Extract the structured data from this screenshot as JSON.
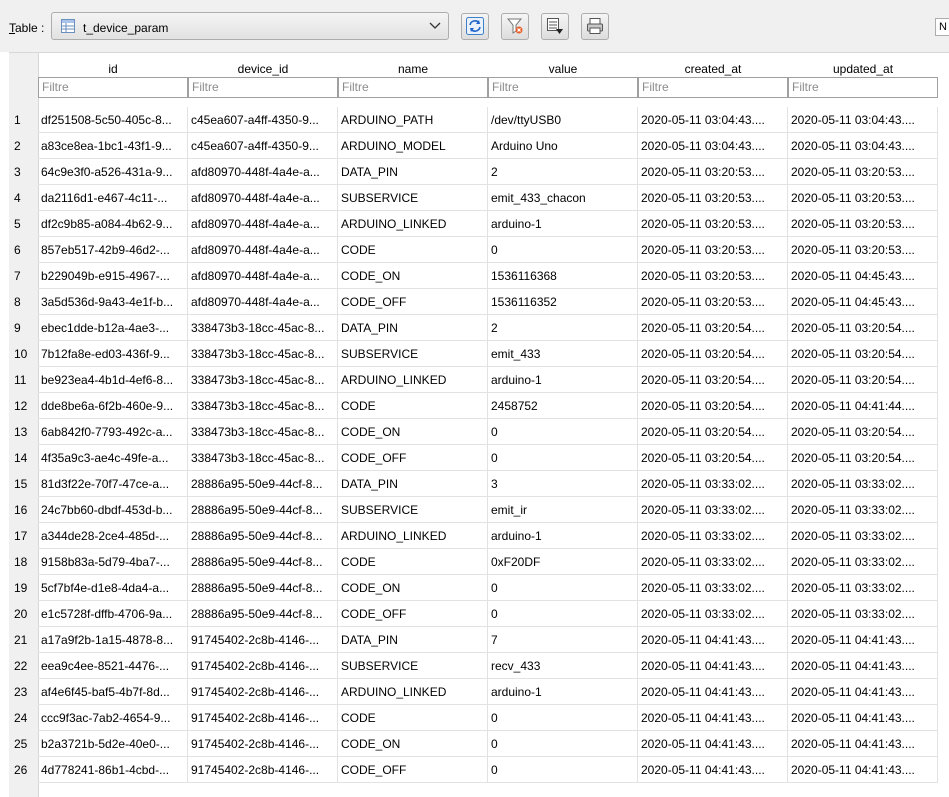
{
  "toolbar": {
    "table_label_prefix": "T",
    "table_label_rest": "able :",
    "table_selected": "t_device_param",
    "buttons": [
      {
        "name": "refresh-button",
        "icon": "refresh-icon"
      },
      {
        "name": "clear-filters-button",
        "icon": "filter-clear-icon"
      },
      {
        "name": "export-button",
        "icon": "export-icon"
      },
      {
        "name": "print-button",
        "icon": "printer-icon"
      }
    ],
    "right_tag": "N"
  },
  "table": {
    "columns": [
      "id",
      "device_id",
      "name",
      "value",
      "created_at",
      "updated_at"
    ],
    "filter_placeholder": "Filtre",
    "rows": [
      {
        "n": "1",
        "id": "df251508-5c50-405c-8...",
        "device_id": "c45ea607-a4ff-4350-9...",
        "name": "ARDUINO_PATH",
        "value": "/dev/ttyUSB0",
        "created_at": "2020-05-11 03:04:43....",
        "updated_at": "2020-05-11 03:04:43...."
      },
      {
        "n": "2",
        "id": "a83ce8ea-1bc1-43f1-9...",
        "device_id": "c45ea607-a4ff-4350-9...",
        "name": "ARDUINO_MODEL",
        "value": "Arduino Uno",
        "created_at": "2020-05-11 03:04:43....",
        "updated_at": "2020-05-11 03:04:43...."
      },
      {
        "n": "3",
        "id": "64c9e3f0-a526-431a-9...",
        "device_id": "afd80970-448f-4a4e-a...",
        "name": "DATA_PIN",
        "value": "2",
        "created_at": "2020-05-11 03:20:53....",
        "updated_at": "2020-05-11 03:20:53...."
      },
      {
        "n": "4",
        "id": "da2116d1-e467-4c11-...",
        "device_id": "afd80970-448f-4a4e-a...",
        "name": "SUBSERVICE",
        "value": "emit_433_chacon",
        "created_at": "2020-05-11 03:20:53....",
        "updated_at": "2020-05-11 03:20:53...."
      },
      {
        "n": "5",
        "id": "df2c9b85-a084-4b62-9...",
        "device_id": "afd80970-448f-4a4e-a...",
        "name": "ARDUINO_LINKED",
        "value": "arduino-1",
        "created_at": "2020-05-11 03:20:53....",
        "updated_at": "2020-05-11 03:20:53...."
      },
      {
        "n": "6",
        "id": "857eb517-42b9-46d2-...",
        "device_id": "afd80970-448f-4a4e-a...",
        "name": "CODE",
        "value": "0",
        "created_at": "2020-05-11 03:20:53....",
        "updated_at": "2020-05-11 03:20:53...."
      },
      {
        "n": "7",
        "id": "b229049b-e915-4967-...",
        "device_id": "afd80970-448f-4a4e-a...",
        "name": "CODE_ON",
        "value": "1536116368",
        "created_at": "2020-05-11 03:20:53....",
        "updated_at": "2020-05-11 04:45:43...."
      },
      {
        "n": "8",
        "id": "3a5d536d-9a43-4e1f-b...",
        "device_id": "afd80970-448f-4a4e-a...",
        "name": "CODE_OFF",
        "value": "1536116352",
        "created_at": "2020-05-11 03:20:53....",
        "updated_at": "2020-05-11 04:45:43...."
      },
      {
        "n": "9",
        "id": "ebec1dde-b12a-4ae3-...",
        "device_id": "338473b3-18cc-45ac-8...",
        "name": "DATA_PIN",
        "value": "2",
        "created_at": "2020-05-11 03:20:54....",
        "updated_at": "2020-05-11 03:20:54...."
      },
      {
        "n": "10",
        "id": "7b12fa8e-ed03-436f-9...",
        "device_id": "338473b3-18cc-45ac-8...",
        "name": "SUBSERVICE",
        "value": "emit_433",
        "created_at": "2020-05-11 03:20:54....",
        "updated_at": "2020-05-11 03:20:54...."
      },
      {
        "n": "11",
        "id": "be923ea4-4b1d-4ef6-8...",
        "device_id": "338473b3-18cc-45ac-8...",
        "name": "ARDUINO_LINKED",
        "value": "arduino-1",
        "created_at": "2020-05-11 03:20:54....",
        "updated_at": "2020-05-11 03:20:54...."
      },
      {
        "n": "12",
        "id": "dde8be6a-6f2b-460e-9...",
        "device_id": "338473b3-18cc-45ac-8...",
        "name": "CODE",
        "value": "2458752",
        "created_at": "2020-05-11 03:20:54....",
        "updated_at": "2020-05-11 04:41:44...."
      },
      {
        "n": "13",
        "id": "6ab842f0-7793-492c-a...",
        "device_id": "338473b3-18cc-45ac-8...",
        "name": "CODE_ON",
        "value": "0",
        "created_at": "2020-05-11 03:20:54....",
        "updated_at": "2020-05-11 03:20:54...."
      },
      {
        "n": "14",
        "id": "4f35a9c3-ae4c-49fe-a...",
        "device_id": "338473b3-18cc-45ac-8...",
        "name": "CODE_OFF",
        "value": "0",
        "created_at": "2020-05-11 03:20:54....",
        "updated_at": "2020-05-11 03:20:54...."
      },
      {
        "n": "15",
        "id": "81d3f22e-70f7-47ce-a...",
        "device_id": "28886a95-50e9-44cf-8...",
        "name": "DATA_PIN",
        "value": "3",
        "created_at": "2020-05-11 03:33:02....",
        "updated_at": "2020-05-11 03:33:02...."
      },
      {
        "n": "16",
        "id": "24c7bb60-dbdf-453d-b...",
        "device_id": "28886a95-50e9-44cf-8...",
        "name": "SUBSERVICE",
        "value": "emit_ir",
        "created_at": "2020-05-11 03:33:02....",
        "updated_at": "2020-05-11 03:33:02...."
      },
      {
        "n": "17",
        "id": "a344de28-2ce4-485d-...",
        "device_id": "28886a95-50e9-44cf-8...",
        "name": "ARDUINO_LINKED",
        "value": "arduino-1",
        "created_at": "2020-05-11 03:33:02....",
        "updated_at": "2020-05-11 03:33:02...."
      },
      {
        "n": "18",
        "id": "9158b83a-5d79-4ba7-...",
        "device_id": "28886a95-50e9-44cf-8...",
        "name": "CODE",
        "value": "0xF20DF",
        "created_at": "2020-05-11 03:33:02....",
        "updated_at": "2020-05-11 03:33:02...."
      },
      {
        "n": "19",
        "id": "5cf7bf4e-d1e8-4da4-a...",
        "device_id": "28886a95-50e9-44cf-8...",
        "name": "CODE_ON",
        "value": "0",
        "created_at": "2020-05-11 03:33:02....",
        "updated_at": "2020-05-11 03:33:02...."
      },
      {
        "n": "20",
        "id": "e1c5728f-dffb-4706-9a...",
        "device_id": "28886a95-50e9-44cf-8...",
        "name": "CODE_OFF",
        "value": "0",
        "created_at": "2020-05-11 03:33:02....",
        "updated_at": "2020-05-11 03:33:02...."
      },
      {
        "n": "21",
        "id": "a17a9f2b-1a15-4878-8...",
        "device_id": "91745402-2c8b-4146-...",
        "name": "DATA_PIN",
        "value": "7",
        "created_at": "2020-05-11 04:41:43....",
        "updated_at": "2020-05-11 04:41:43...."
      },
      {
        "n": "22",
        "id": "eea9c4ee-8521-4476-...",
        "device_id": "91745402-2c8b-4146-...",
        "name": "SUBSERVICE",
        "value": "recv_433",
        "created_at": "2020-05-11 04:41:43....",
        "updated_at": "2020-05-11 04:41:43...."
      },
      {
        "n": "23",
        "id": "af4e6f45-baf5-4b7f-8d...",
        "device_id": "91745402-2c8b-4146-...",
        "name": "ARDUINO_LINKED",
        "value": "arduino-1",
        "created_at": "2020-05-11 04:41:43....",
        "updated_at": "2020-05-11 04:41:43...."
      },
      {
        "n": "24",
        "id": "ccc9f3ac-7ab2-4654-9...",
        "device_id": "91745402-2c8b-4146-...",
        "name": "CODE",
        "value": "0",
        "created_at": "2020-05-11 04:41:43....",
        "updated_at": "2020-05-11 04:41:43...."
      },
      {
        "n": "25",
        "id": "b2a3721b-5d2e-40e0-...",
        "device_id": "91745402-2c8b-4146-...",
        "name": "CODE_ON",
        "value": "0",
        "created_at": "2020-05-11 04:41:43....",
        "updated_at": "2020-05-11 04:41:43...."
      },
      {
        "n": "26",
        "id": "4d778241-86b1-4cbd-...",
        "device_id": "91745402-2c8b-4146-...",
        "name": "CODE_OFF",
        "value": "0",
        "created_at": "2020-05-11 04:41:43....",
        "updated_at": "2020-05-11 04:41:43...."
      }
    ]
  }
}
